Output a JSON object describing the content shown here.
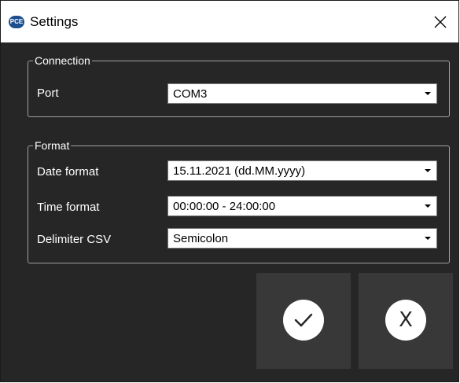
{
  "window": {
    "title": "Settings",
    "app_icon_text": "PCE",
    "icons": {
      "app": "pce-logo-icon",
      "close": "close-icon"
    }
  },
  "connection": {
    "legend": "Connection",
    "port_label": "Port",
    "port_value": "COM3"
  },
  "format": {
    "legend": "Format",
    "date_label": "Date format",
    "date_value": "15.11.2021 (dd.MM.yyyy)",
    "time_label": "Time format",
    "time_value": "00:00:00 - 24:00:00",
    "delimiter_label": "Delimiter CSV",
    "delimiter_value": "Semicolon"
  },
  "actions": {
    "confirm_icon": "checkmark-icon",
    "cancel_icon_text": "X"
  },
  "colors": {
    "background": "#262626",
    "button_bg": "#383838",
    "text": "#ffffff"
  }
}
